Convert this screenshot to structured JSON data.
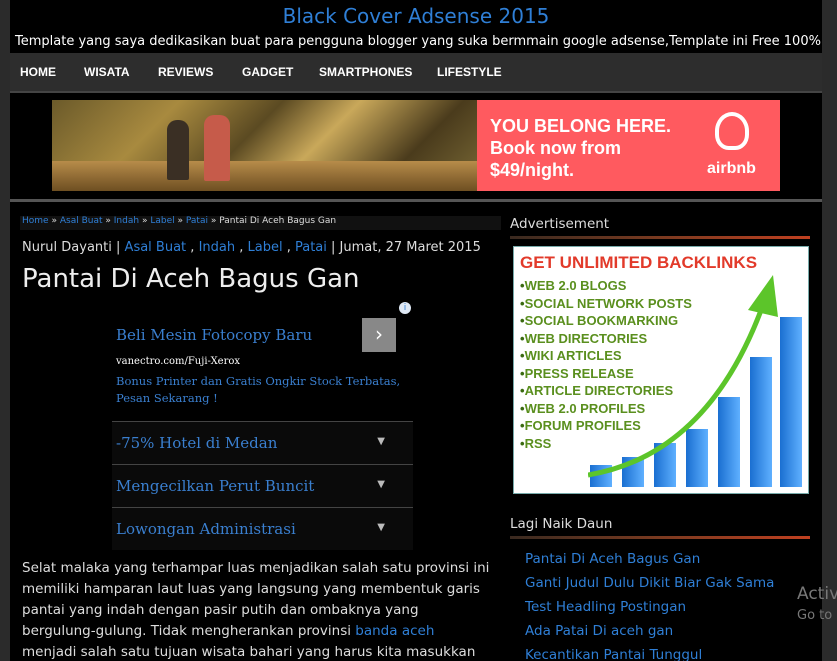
{
  "header": {
    "title": "Black Cover Adsense 2015",
    "description": "Template yang saya dedikasikan buat para pengguna blogger yang suka bermmain google adsense,Template ini Free 100%"
  },
  "nav": [
    "HOME",
    "WISATA",
    "REVIEWS",
    "GADGET",
    "SMARTPHONES",
    "LIFESTYLE"
  ],
  "banner": {
    "ad_lines": [
      "YOU BELONG HERE.",
      "Book now from",
      "$49/night."
    ],
    "brand": "airbnb",
    "brand_color": "#ff5a5f"
  },
  "breadcrumb": {
    "links": [
      "Home",
      "Asal Buat",
      "Indah",
      "Label",
      "Patai"
    ],
    "separator": "»",
    "current": "Pantai Di Aceh Bagus Gan"
  },
  "post": {
    "author": "Nurul Dayanti",
    "labels": [
      "Asal Buat",
      "Indah",
      "Label",
      "Patai"
    ],
    "date": "Jumat, 27 Maret 2015",
    "title": "Pantai Di Aceh Bagus Gan",
    "body_before_link": "Selat malaka yang terhampar luas menjadikan salah satu provinsi ini memiliki hamparan laut luas yang langsung yang membentuk garis pantai yang indah dengan pasir putih dan ombaknya yang bergulung-gulung. Tidak mengherankan provinsi",
    "body_link": "banda aceh",
    "body_after_link": "menjadi salah satu tujuan wisata bahari yang harus kita masukkan dalam daftar traveling"
  },
  "adsense": {
    "title": "Beli Mesin Fotocopy Baru",
    "url": "vanectro.com/Fuji-Xerox",
    "description": "Bonus Printer dan Gratis Ongkir Stock Terbatas, Pesan Sekarang !",
    "links": [
      "-75% Hotel di Medan",
      "Mengecilkan Perut Buncit",
      "Lowongan Administrasi"
    ],
    "arrow_icon": "chevron-right-icon",
    "info_icon": "info-icon"
  },
  "sidebar": {
    "advertisement_heading": "Advertisement",
    "ad_image": {
      "headline": "GET UNLIMITED BACKLINKS",
      "items": [
        "WEB 2.0 BLOGS",
        "SOCIAL NETWORK POSTS",
        "SOCIAL BOOKMARKING",
        "WEB DIRECTORIES",
        "WIKI ARTICLES",
        "PRESS RELEASE",
        "ARTICLE DIRECTORIES",
        "WEB 2.0 PROFILES",
        "FORUM PROFILES",
        "RSS"
      ]
    },
    "popular_heading": "Lagi Naik Daun",
    "popular_posts": [
      "Pantai Di Aceh Bagus Gan",
      "Ganti Judul Dulu Dikit Biar Gak Sama",
      "Test Headling Postingan",
      "Ada Patai Di aceh gan",
      "Kecantikan Pantai Tunggul"
    ]
  },
  "overlay": {
    "line1": "Activ",
    "line2": "Go to"
  },
  "colors": {
    "link": "#2f7fd6",
    "background": "#000000",
    "accent_line": "#c04020"
  }
}
